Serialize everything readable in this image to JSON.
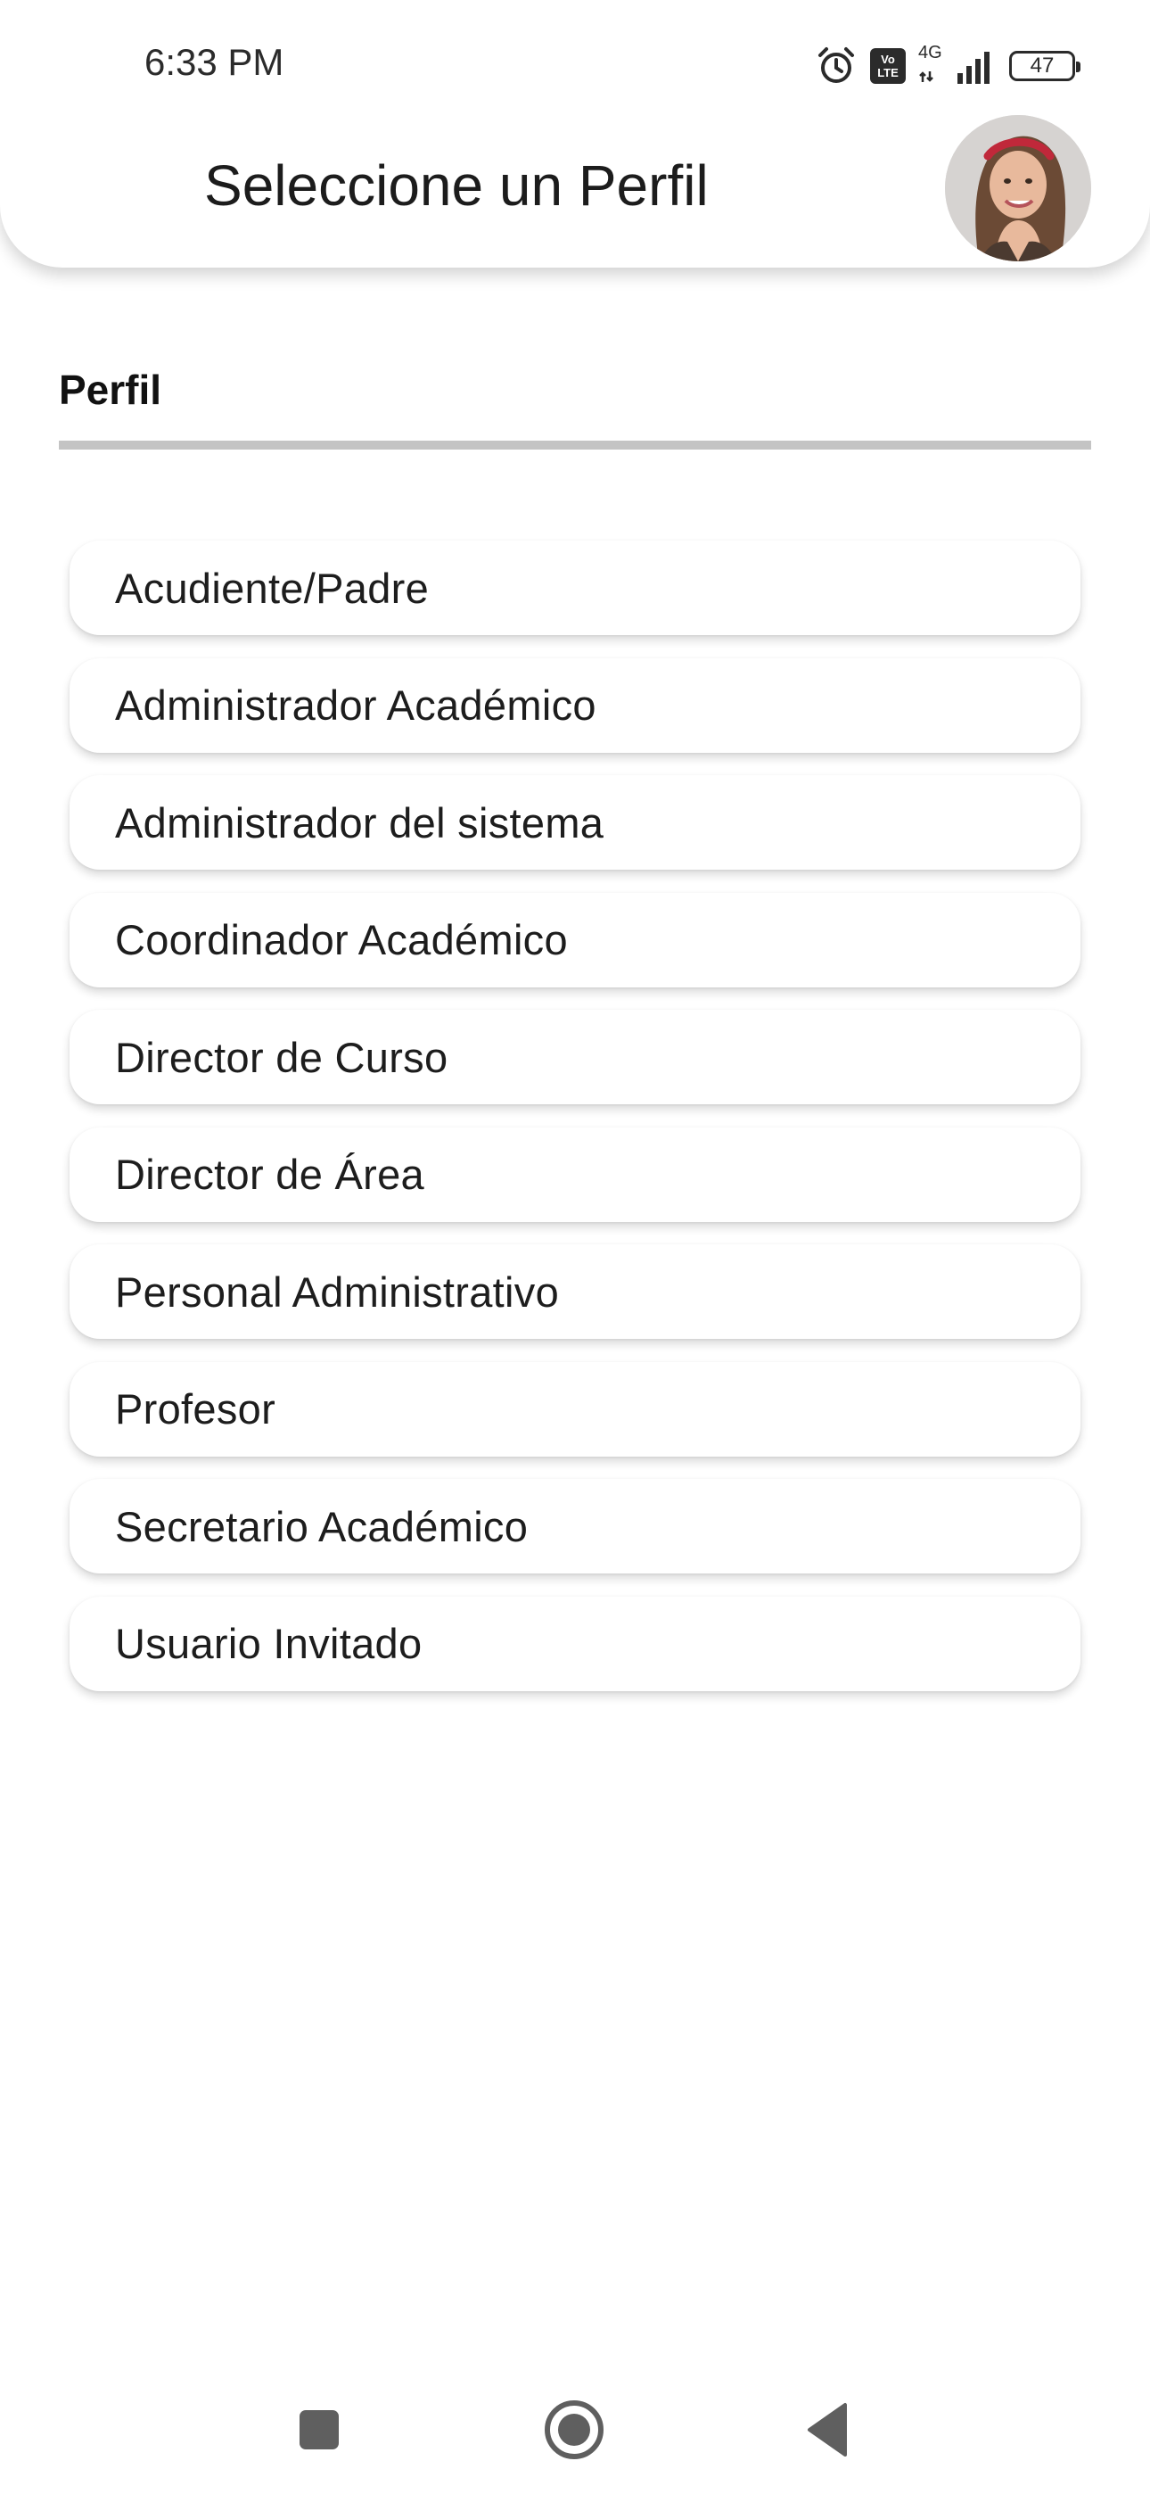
{
  "status_bar": {
    "time": "6:33 PM",
    "volte_line1": "Vo",
    "volte_line2": "LTE",
    "network": "4G",
    "battery": "47"
  },
  "app_bar": {
    "title": "Seleccione un Perfil"
  },
  "section": {
    "label": "Perfil"
  },
  "profiles": [
    "Acudiente/Padre",
    "Administrador Académico",
    "Administrador del sistema",
    "Coordinador Académico",
    "Director de Curso",
    "Director de Área",
    "Personal Administrativo",
    "Profesor",
    "Secretario Académico",
    "Usuario Invitado"
  ],
  "nav_bar": {
    "recents_icon": "square-icon",
    "home_icon": "circle-home-icon",
    "back_icon": "triangle-back-icon"
  }
}
